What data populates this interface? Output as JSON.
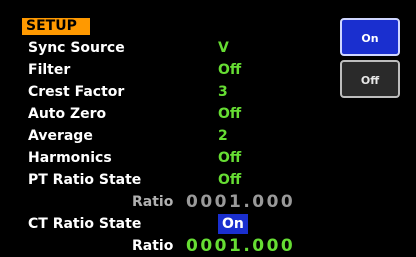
{
  "title": "SETUP",
  "rows": [
    {
      "label": "Sync Source",
      "value": "V"
    },
    {
      "label": "Filter",
      "value": "Off"
    },
    {
      "label": "Crest Factor",
      "value": "3"
    },
    {
      "label": "Auto Zero",
      "value": "Off"
    },
    {
      "label": "Average",
      "value": "2"
    },
    {
      "label": "Harmonics",
      "value": "Off"
    },
    {
      "label": "PT Ratio State",
      "value": "Off"
    },
    {
      "label": "Ratio",
      "value": "0001.000"
    },
    {
      "label": "CT Ratio State",
      "value": "On"
    },
    {
      "label": "Ratio",
      "value": "0001.000"
    }
  ],
  "buttons": {
    "on_label": "On",
    "off_label": "Off"
  },
  "colors": {
    "title_bg": "#ff9900",
    "value_green": "#66dd33",
    "select_blue": "#1a2fcf"
  }
}
